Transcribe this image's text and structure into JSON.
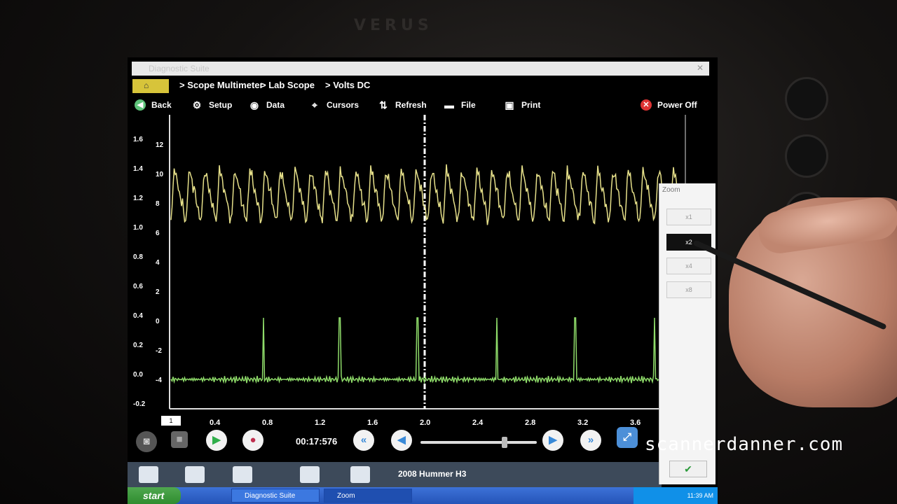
{
  "device": {
    "brand": "VERUS"
  },
  "window": {
    "title": "Diagnostic Suite"
  },
  "breadcrumb": {
    "home_label": "",
    "items": [
      "> Scope Multimeter",
      "> Lab Scope",
      "> Volts DC"
    ]
  },
  "toolbar": {
    "back": "Back",
    "setup": "Setup",
    "data": "Data",
    "cursors": "Cursors",
    "refresh": "Refresh",
    "file": "File",
    "print": "Print",
    "power_off": "Power Off"
  },
  "scope": {
    "y_left_ticks": [
      "1.6",
      "1.4",
      "1.2",
      "1.0",
      "0.8",
      "0.6",
      "0.4",
      "0.2",
      "0.0",
      "-0.2"
    ],
    "y_right_ticks": [
      "12",
      "10",
      "8",
      "6",
      "4",
      "2",
      "0",
      "-2",
      "-4"
    ],
    "x_ticks": [
      "0.4",
      "0.8",
      "1.2",
      "1.6",
      "2.0",
      "2.4",
      "2.8",
      "3.2",
      "3.6"
    ],
    "cursor_label": "1",
    "colors": {
      "channel1": "#e6e08a",
      "channel2": "#8fdc6a"
    }
  },
  "playback": {
    "time": "00:17:576",
    "position": 0.72
  },
  "bottom": {
    "vehicle": "2008 Hummer H3"
  },
  "taskbar": {
    "start": "start",
    "tasks": [
      "Diagnostic Suite",
      "Zoom"
    ],
    "clock": "11:39 AM"
  },
  "zoom": {
    "title": "Zoom",
    "options": [
      "x1",
      "x2",
      "x4",
      "x8"
    ],
    "active": "x2",
    "ok_icon": "check-icon"
  },
  "watermark": "scannerdanner.com"
}
